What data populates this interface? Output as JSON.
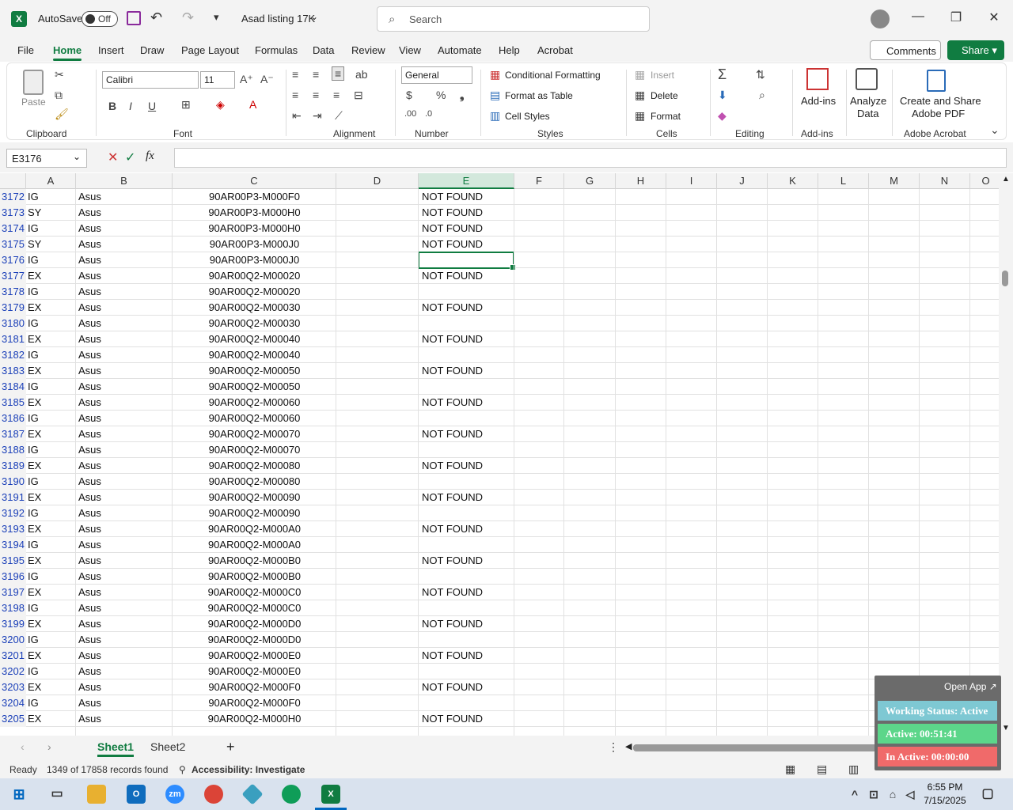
{
  "titlebar": {
    "autosave_label": "AutoSave",
    "autosave_state": "Off",
    "file_name": "Asad listing 17K",
    "search_placeholder": "Search"
  },
  "menu": [
    "File",
    "Home",
    "Insert",
    "Draw",
    "Page Layout",
    "Formulas",
    "Data",
    "Review",
    "View",
    "Automate",
    "Help",
    "Acrobat"
  ],
  "menu_active": "Home",
  "comments_label": "Comments",
  "share_label": "Share",
  "ribbon": {
    "paste": "Paste",
    "font_name": "Calibri",
    "font_size": "11",
    "number_format": "General",
    "conditional_formatting": "Conditional Formatting",
    "format_as_table": "Format as Table",
    "cell_styles": "Cell Styles",
    "insert": "Insert",
    "delete": "Delete",
    "format": "Format",
    "add_ins": "Add-ins",
    "analyze_data_1": "Analyze",
    "analyze_data_2": "Data",
    "create_share_1": "Create and Share",
    "create_share_2": "Adobe PDF",
    "groups": {
      "clipboard": "Clipboard",
      "font": "Font",
      "alignment": "Alignment",
      "number": "Number",
      "styles": "Styles",
      "cells": "Cells",
      "editing": "Editing",
      "addins": "Add-ins",
      "acrobat": "Adobe Acrobat"
    }
  },
  "name_box": "E3176",
  "columns": [
    "A",
    "B",
    "C",
    "D",
    "E",
    "F",
    "G",
    "H",
    "I",
    "J",
    "K",
    "L",
    "M",
    "N",
    "O"
  ],
  "rows": [
    {
      "n": "3172",
      "a": "IG",
      "b": "Asus",
      "c": "90AR00P3-M000F0",
      "e": "NOT FOUND"
    },
    {
      "n": "3173",
      "a": "SY",
      "b": "Asus",
      "c": "90AR00P3-M000H0",
      "e": "NOT FOUND"
    },
    {
      "n": "3174",
      "a": "IG",
      "b": "Asus",
      "c": "90AR00P3-M000H0",
      "e": "NOT FOUND"
    },
    {
      "n": "3175",
      "a": "SY",
      "b": "Asus",
      "c": "90AR00P3-M000J0",
      "e": "NOT FOUND"
    },
    {
      "n": "3176",
      "a": "IG",
      "b": "Asus",
      "c": "90AR00P3-M000J0",
      "e": ""
    },
    {
      "n": "3177",
      "a": "EX",
      "b": "Asus",
      "c": "90AR00Q2-M00020",
      "e": "NOT FOUND"
    },
    {
      "n": "3178",
      "a": "IG",
      "b": "Asus",
      "c": "90AR00Q2-M00020",
      "e": ""
    },
    {
      "n": "3179",
      "a": "EX",
      "b": "Asus",
      "c": "90AR00Q2-M00030",
      "e": "NOT FOUND"
    },
    {
      "n": "3180",
      "a": "IG",
      "b": "Asus",
      "c": "90AR00Q2-M00030",
      "e": ""
    },
    {
      "n": "3181",
      "a": "EX",
      "b": "Asus",
      "c": "90AR00Q2-M00040",
      "e": "NOT FOUND"
    },
    {
      "n": "3182",
      "a": "IG",
      "b": "Asus",
      "c": "90AR00Q2-M00040",
      "e": ""
    },
    {
      "n": "3183",
      "a": "EX",
      "b": "Asus",
      "c": "90AR00Q2-M00050",
      "e": "NOT FOUND"
    },
    {
      "n": "3184",
      "a": "IG",
      "b": "Asus",
      "c": "90AR00Q2-M00050",
      "e": ""
    },
    {
      "n": "3185",
      "a": "EX",
      "b": "Asus",
      "c": "90AR00Q2-M00060",
      "e": "NOT FOUND"
    },
    {
      "n": "3186",
      "a": "IG",
      "b": "Asus",
      "c": "90AR00Q2-M00060",
      "e": ""
    },
    {
      "n": "3187",
      "a": "EX",
      "b": "Asus",
      "c": "90AR00Q2-M00070",
      "e": "NOT FOUND"
    },
    {
      "n": "3188",
      "a": "IG",
      "b": "Asus",
      "c": "90AR00Q2-M00070",
      "e": ""
    },
    {
      "n": "3189",
      "a": "EX",
      "b": "Asus",
      "c": "90AR00Q2-M00080",
      "e": "NOT FOUND"
    },
    {
      "n": "3190",
      "a": "IG",
      "b": "Asus",
      "c": "90AR00Q2-M00080",
      "e": ""
    },
    {
      "n": "3191",
      "a": "EX",
      "b": "Asus",
      "c": "90AR00Q2-M00090",
      "e": "NOT FOUND"
    },
    {
      "n": "3192",
      "a": "IG",
      "b": "Asus",
      "c": "90AR00Q2-M00090",
      "e": ""
    },
    {
      "n": "3193",
      "a": "EX",
      "b": "Asus",
      "c": "90AR00Q2-M000A0",
      "e": "NOT FOUND"
    },
    {
      "n": "3194",
      "a": "IG",
      "b": "Asus",
      "c": "90AR00Q2-M000A0",
      "e": ""
    },
    {
      "n": "3195",
      "a": "EX",
      "b": "Asus",
      "c": "90AR00Q2-M000B0",
      "e": "NOT FOUND"
    },
    {
      "n": "3196",
      "a": "IG",
      "b": "Asus",
      "c": "90AR00Q2-M000B0",
      "e": ""
    },
    {
      "n": "3197",
      "a": "EX",
      "b": "Asus",
      "c": "90AR00Q2-M000C0",
      "e": "NOT FOUND"
    },
    {
      "n": "3198",
      "a": "IG",
      "b": "Asus",
      "c": "90AR00Q2-M000C0",
      "e": ""
    },
    {
      "n": "3199",
      "a": "EX",
      "b": "Asus",
      "c": "90AR00Q2-M000D0",
      "e": "NOT FOUND"
    },
    {
      "n": "3200",
      "a": "IG",
      "b": "Asus",
      "c": "90AR00Q2-M000D0",
      "e": ""
    },
    {
      "n": "3201",
      "a": "EX",
      "b": "Asus",
      "c": "90AR00Q2-M000E0",
      "e": "NOT FOUND"
    },
    {
      "n": "3202",
      "a": "IG",
      "b": "Asus",
      "c": "90AR00Q2-M000E0",
      "e": ""
    },
    {
      "n": "3203",
      "a": "EX",
      "b": "Asus",
      "c": "90AR00Q2-M000F0",
      "e": "NOT FOUND"
    },
    {
      "n": "3204",
      "a": "IG",
      "b": "Asus",
      "c": "90AR00Q2-M000F0",
      "e": ""
    },
    {
      "n": "3205",
      "a": "EX",
      "b": "Asus",
      "c": "90AR00Q2-M000H0",
      "e": "NOT FOUND"
    }
  ],
  "selected_row": "3176",
  "sheets": [
    "Sheet1",
    "Sheet2"
  ],
  "active_sheet": "Sheet1",
  "status": {
    "mode": "Ready",
    "records": "1349 of 17858 records found",
    "accessibility": "Accessibility: Investigate"
  },
  "widget": {
    "open_app": "Open App ↗",
    "working": "Working Status: Active",
    "active": "Active: 00:51:41",
    "inactive": "In Active: 00:00:00",
    "colors": {
      "working": "#7ec8d3",
      "active": "#5cd68a",
      "inactive": "#f06a6a"
    }
  },
  "taskbar": {
    "time": "6:55 PM",
    "date": "7/15/2025",
    "zoom_label": "zm"
  },
  "colors": {
    "accent": "#107c41"
  }
}
